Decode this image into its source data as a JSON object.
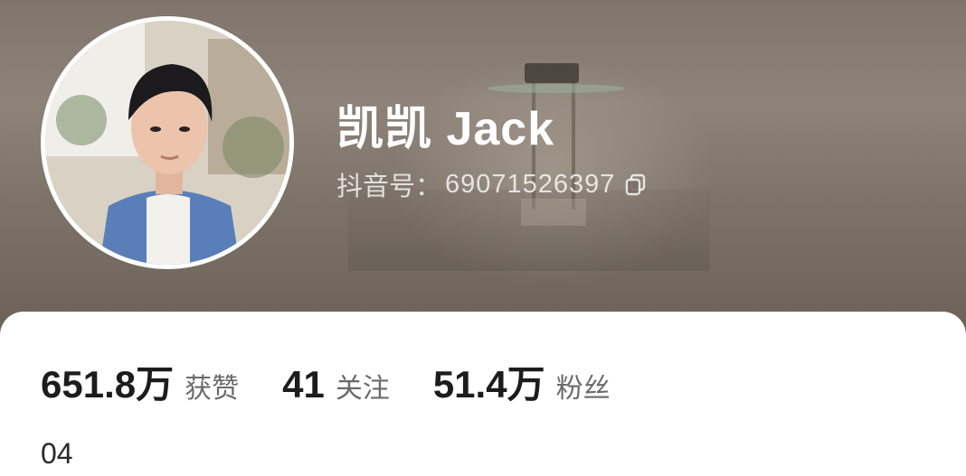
{
  "profile": {
    "name": "凯凯 Jack",
    "id_label": "抖音号：",
    "id_value": "69071526397",
    "avatar_alt": "avatar"
  },
  "icons": {
    "copy": "copy-icon"
  },
  "stats": [
    {
      "value": "651.8万",
      "label": "获赞"
    },
    {
      "value": "41",
      "label": "关注"
    },
    {
      "value": "51.4万",
      "label": "粉丝"
    }
  ],
  "bio": "04",
  "colors": {
    "header_bg": "#8d8378",
    "text_primary": "#1c1c1c",
    "text_secondary": "#6b6b6b",
    "card_bg": "#ffffff"
  }
}
